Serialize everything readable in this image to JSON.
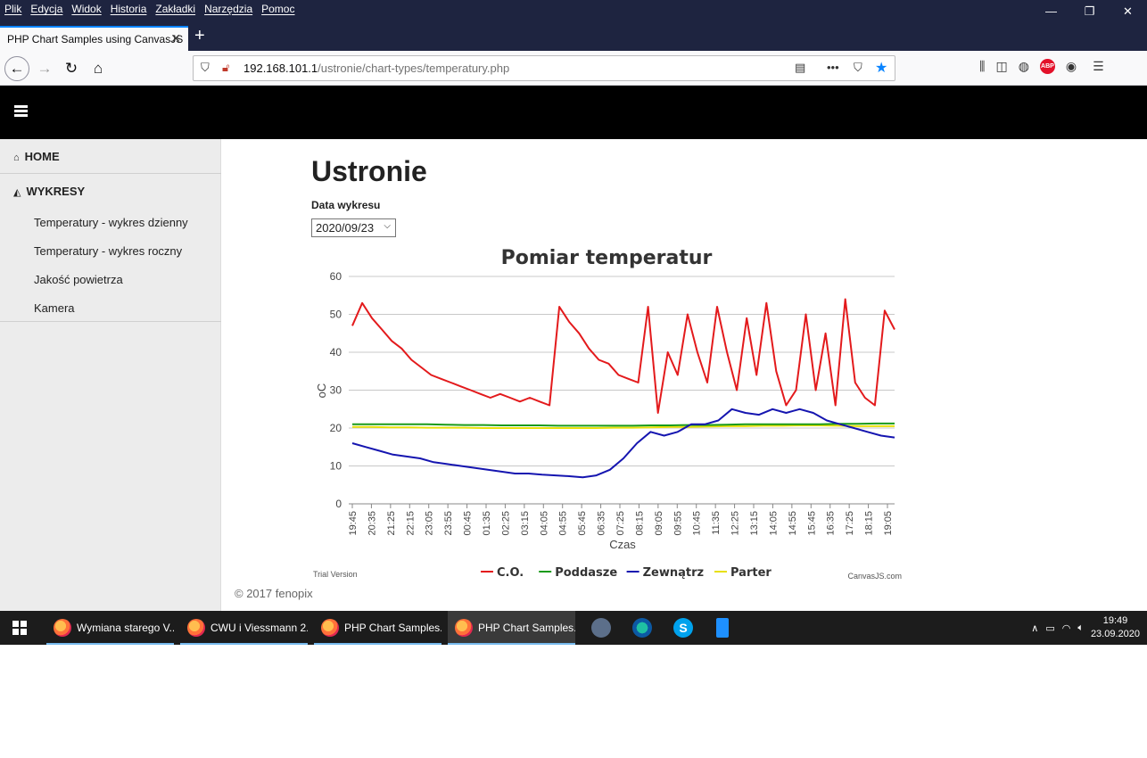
{
  "browser": {
    "menu": [
      "Plik",
      "Edycja",
      "Widok",
      "Historia",
      "Zakładki",
      "Narzędzia",
      "Pomoc"
    ],
    "tab_title": "PHP Chart Samples using CanvasJS",
    "url_host": "192.168.101.1",
    "url_path": "/ustronie/chart-types/temperatury.php"
  },
  "sidebar": {
    "home": "HOME",
    "section": "WYKRESY",
    "items": [
      "Temperatury - wykres dzienny",
      "Temperatury - wykres roczny",
      "Jakość powietrza",
      "Kamera"
    ]
  },
  "page": {
    "title": "Ustronie",
    "date_label": "Data wykresu",
    "date_value": "2020/09/23",
    "footer": "© 2017 fenopix"
  },
  "chart_data": {
    "type": "line",
    "title": "Pomiar temperatur",
    "xlabel": "Czas",
    "ylabel": "oC",
    "ylim": [
      0,
      60
    ],
    "yticks": [
      0,
      10,
      20,
      30,
      40,
      50,
      60
    ],
    "categories": [
      "19:45",
      "20:35",
      "21:25",
      "22:15",
      "23:05",
      "23:55",
      "00:45",
      "01:35",
      "02:25",
      "03:15",
      "04:05",
      "04:55",
      "05:45",
      "06:35",
      "07:25",
      "08:15",
      "09:05",
      "09:55",
      "10:45",
      "11:35",
      "12:25",
      "13:15",
      "14:05",
      "14:55",
      "15:45",
      "16:35",
      "17:25",
      "18:15",
      "19:05"
    ],
    "grid": true,
    "legend_position": "bottom",
    "watermark_left": "Trial Version",
    "watermark_right": "CanvasJS.com",
    "series": [
      {
        "name": "C.O.",
        "color": "#e31a1c",
        "values": [
          47,
          53,
          49,
          46,
          43,
          41,
          38,
          36,
          34,
          33,
          32,
          31,
          30,
          29,
          28,
          29,
          28,
          27,
          28,
          27,
          26,
          52,
          48,
          45,
          41,
          38,
          37,
          34,
          33,
          32,
          52,
          24,
          40,
          34,
          50,
          40,
          32,
          52,
          40,
          30,
          49,
          34,
          53,
          35,
          26,
          30,
          50,
          30,
          45,
          26,
          54,
          32,
          28,
          26,
          51,
          46
        ]
      },
      {
        "name": "Poddasze",
        "color": "#1a9b1a",
        "values": [
          21,
          21,
          21,
          21,
          21,
          20.9,
          20.8,
          20.8,
          20.7,
          20.7,
          20.7,
          20.6,
          20.6,
          20.6,
          20.6,
          20.6,
          20.7,
          20.7,
          20.8,
          20.8,
          20.9,
          21,
          21,
          21,
          21,
          21,
          21.1,
          21.1,
          21.2,
          21.2
        ]
      },
      {
        "name": "Zewnątrz",
        "color": "#1515b0",
        "values": [
          16,
          15,
          14,
          13,
          12.5,
          12,
          11,
          10.5,
          10,
          9.5,
          9,
          8.5,
          8,
          8,
          7.7,
          7.5,
          7.3,
          7,
          7.5,
          9,
          12,
          16,
          19,
          18,
          19,
          21,
          21,
          22,
          25,
          24,
          23.5,
          25,
          24,
          25,
          24,
          22,
          21,
          20,
          19,
          18,
          17.5
        ]
      },
      {
        "name": "Parter",
        "color": "#e8e00a",
        "values": [
          20.3,
          20.3,
          20.2,
          20.2,
          20.1,
          20.1,
          20.1,
          20,
          20,
          20,
          20,
          20,
          20,
          20,
          20.1,
          20.1,
          20.2,
          20.3,
          20.3,
          20.4,
          20.5,
          20.5,
          20.6,
          20.6,
          20.7,
          20.7,
          20.6,
          20.5,
          20.5,
          20.5
        ]
      }
    ]
  },
  "taskbar": {
    "tasks": [
      "Wymiana starego V...",
      "CWU i Viessmann 2...",
      "PHP Chart Samples...",
      "PHP Chart Samples..."
    ],
    "time": "19:49",
    "date": "23.09.2020"
  }
}
